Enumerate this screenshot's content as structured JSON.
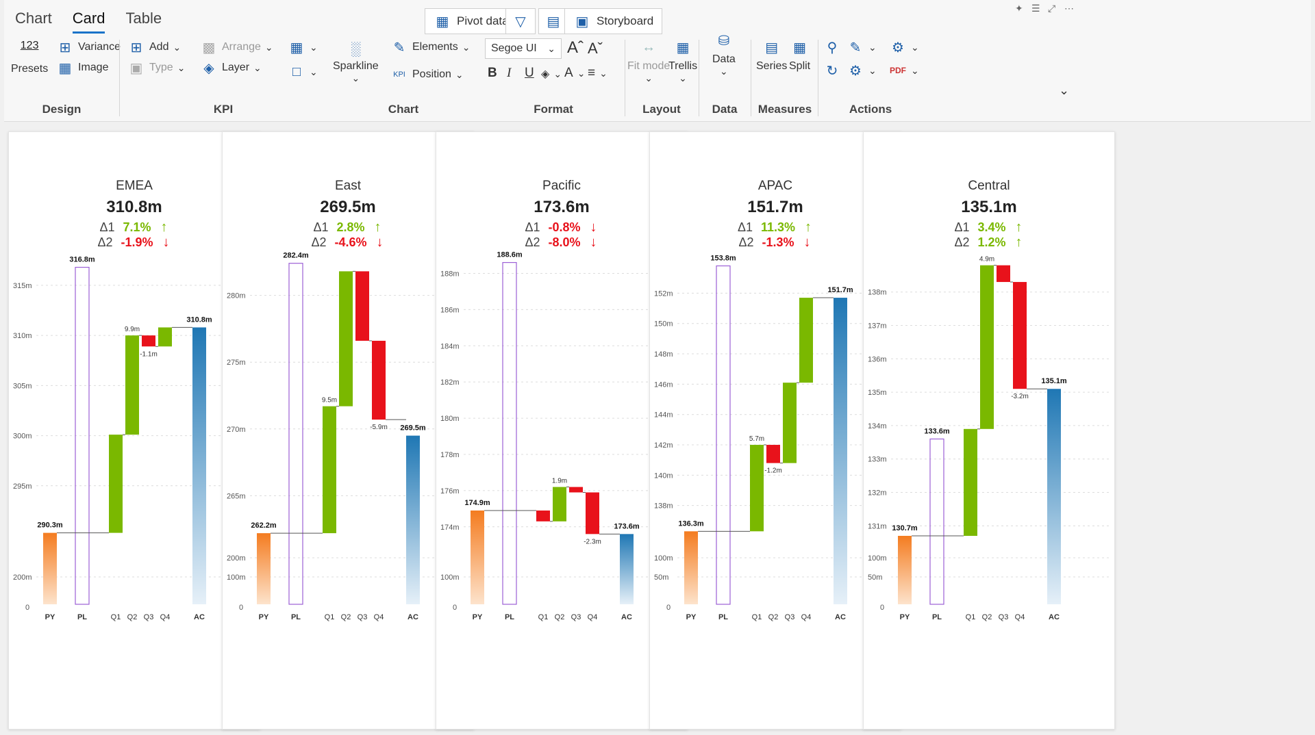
{
  "tabs": [
    {
      "label": "Chart"
    },
    {
      "label": "Card"
    },
    {
      "label": "Table"
    }
  ],
  "top_buttons": {
    "pivot": "Pivot data",
    "storyboard": "Storyboard"
  },
  "ribbon": {
    "design": {
      "label": "Design",
      "presets_num": "123",
      "presets": "Presets",
      "variance": "Variance",
      "image": "Image"
    },
    "kpi": {
      "label": "KPI",
      "add": "Add",
      "type": "Type",
      "arrange": "Arrange",
      "layer": "Layer"
    },
    "chart": {
      "label": "Chart",
      "sparkline": "Sparkline",
      "elements": "Elements",
      "position": "Position"
    },
    "format": {
      "label": "Format",
      "font": "Segoe UI",
      "bold": "B",
      "italic": "I",
      "underline": "U"
    },
    "layout": {
      "label": "Layout",
      "fit": "Fit mode",
      "trellis": "Trellis"
    },
    "data": {
      "label": "Data",
      "data_btn": "Data"
    },
    "measures": {
      "label": "Measures",
      "series": "Series",
      "split": "Split"
    },
    "actions": {
      "label": "Actions"
    }
  },
  "colors": {
    "py": "#f47c20",
    "pl": "#9b5fd6",
    "up": "#7ab800",
    "down": "#e8121b",
    "ac": "#1f77b4",
    "accent": "#1a73c9"
  },
  "delta_labels": {
    "d1": "Δ1",
    "d2": "Δ2"
  },
  "chart_data": [
    {
      "type": "bar",
      "title": "EMEA",
      "value": "310.8m",
      "d1": "7.1%",
      "d1_dir": "up",
      "d2": "-1.9%",
      "d2_dir": "down",
      "categories": [
        "PY",
        "PL",
        "Q1",
        "Q2",
        "Q3",
        "Q4",
        "AC"
      ],
      "py": 290.3,
      "pl": 316.8,
      "ac": 310.8,
      "quarters": [
        {
          "delta": 9.8,
          "label": ""
        },
        {
          "delta": 9.9,
          "label": "9.9m"
        },
        {
          "delta": -1.1,
          "label": "-1.1m"
        },
        {
          "delta": 1.9,
          "label": ""
        }
      ],
      "ylim": [
        290,
        318
      ],
      "ticks": [
        {
          "v": 315,
          "t": "315m"
        },
        {
          "v": 310,
          "t": "310m"
        },
        {
          "v": 305,
          "t": "305m"
        },
        {
          "v": 300,
          "t": "300m"
        },
        {
          "v": 295,
          "t": "295m"
        }
      ],
      "lower_ticks": [
        {
          "t": "200m"
        }
      ],
      "labels": {
        "py": "290.3m",
        "pl": "316.8m",
        "ac": "310.8m"
      }
    },
    {
      "type": "bar",
      "title": "East",
      "value": "269.5m",
      "d1": "2.8%",
      "d1_dir": "up",
      "d2": "-4.6%",
      "d2_dir": "down",
      "categories": [
        "PY",
        "PL",
        "Q1",
        "Q2",
        "Q3",
        "Q4",
        "AC"
      ],
      "py": 262.2,
      "pl": 282.4,
      "ac": 269.5,
      "quarters": [
        {
          "delta": 9.5,
          "label": "9.5m"
        },
        {
          "delta": 10.1,
          "label": ""
        },
        {
          "delta": -5.2,
          "label": ""
        },
        {
          "delta": -5.9,
          "label": "-5.9m"
        }
      ],
      "ylim": [
        262,
        283
      ],
      "ticks": [
        {
          "v": 280,
          "t": "280m"
        },
        {
          "v": 275,
          "t": "275m"
        },
        {
          "v": 270,
          "t": "270m"
        },
        {
          "v": 265,
          "t": "265m"
        }
      ],
      "lower_ticks": [
        {
          "t": "200m"
        },
        {
          "t": "100m"
        }
      ],
      "labels": {
        "py": "262.2m",
        "pl": "282.4m",
        "ac": "269.5m"
      }
    },
    {
      "type": "bar",
      "title": "Pacific",
      "value": "173.6m",
      "d1": "-0.8%",
      "d1_dir": "down",
      "d2": "-8.0%",
      "d2_dir": "down",
      "categories": [
        "PY",
        "PL",
        "Q1",
        "Q2",
        "Q3",
        "Q4",
        "AC"
      ],
      "py": 174.9,
      "pl": 188.6,
      "ac": 173.6,
      "quarters": [
        {
          "delta": -0.6,
          "label": ""
        },
        {
          "delta": 1.9,
          "label": "1.9m"
        },
        {
          "delta": -0.3,
          "label": ""
        },
        {
          "delta": -2.3,
          "label": "-2.3m"
        }
      ],
      "ylim": [
        173.5,
        189
      ],
      "ticks": [
        {
          "v": 188,
          "t": "188m"
        },
        {
          "v": 186,
          "t": "186m"
        },
        {
          "v": 184,
          "t": "184m"
        },
        {
          "v": 182,
          "t": "182m"
        },
        {
          "v": 180,
          "t": "180m"
        },
        {
          "v": 178,
          "t": "178m"
        },
        {
          "v": 176,
          "t": "176m"
        },
        {
          "v": 174,
          "t": "174m"
        }
      ],
      "lower_ticks": [
        {
          "t": "100m"
        }
      ],
      "labels": {
        "py": "174.9m",
        "pl": "188.6m",
        "ac": "173.6m"
      }
    },
    {
      "type": "bar",
      "title": "APAC",
      "value": "151.7m",
      "d1": "11.3%",
      "d1_dir": "up",
      "d2": "-1.3%",
      "d2_dir": "down",
      "categories": [
        "PY",
        "PL",
        "Q1",
        "Q2",
        "Q3",
        "Q4",
        "AC"
      ],
      "py": 136.3,
      "pl": 153.8,
      "ac": 151.7,
      "quarters": [
        {
          "delta": 5.7,
          "label": "5.7m"
        },
        {
          "delta": -1.2,
          "label": "-1.2m"
        },
        {
          "delta": 5.3,
          "label": ""
        },
        {
          "delta": 5.6,
          "label": ""
        }
      ],
      "ylim": [
        136,
        154.5
      ],
      "ticks": [
        {
          "v": 152,
          "t": "152m"
        },
        {
          "v": 150,
          "t": "150m"
        },
        {
          "v": 148,
          "t": "148m"
        },
        {
          "v": 146,
          "t": "146m"
        },
        {
          "v": 144,
          "t": "144m"
        },
        {
          "v": 142,
          "t": "142m"
        },
        {
          "v": 140,
          "t": "140m"
        },
        {
          "v": 138,
          "t": "138m"
        }
      ],
      "lower_ticks": [
        {
          "t": "100m"
        },
        {
          "t": "50m"
        }
      ],
      "labels": {
        "py": "136.3m",
        "pl": "153.8m",
        "ac": "151.7m"
      }
    },
    {
      "type": "bar",
      "title": "Central",
      "value": "135.1m",
      "d1": "3.4%",
      "d1_dir": "up",
      "d2": "1.2%",
      "d2_dir": "up",
      "categories": [
        "PY",
        "PL",
        "Q1",
        "Q2",
        "Q3",
        "Q4",
        "AC"
      ],
      "py": 130.7,
      "pl": 133.6,
      "ac": 135.1,
      "quarters": [
        {
          "delta": 3.2,
          "label": ""
        },
        {
          "delta": 4.9,
          "label": "4.9m"
        },
        {
          "delta": -0.5,
          "label": ""
        },
        {
          "delta": -3.2,
          "label": "-3.2m"
        }
      ],
      "ylim": [
        130.7,
        139.1
      ],
      "ticks": [
        {
          "v": 138,
          "t": "138m"
        },
        {
          "v": 137,
          "t": "137m"
        },
        {
          "v": 136,
          "t": "136m"
        },
        {
          "v": 135,
          "t": "135m"
        },
        {
          "v": 134,
          "t": "134m"
        },
        {
          "v": 133,
          "t": "133m"
        },
        {
          "v": 132,
          "t": "132m"
        },
        {
          "v": 131,
          "t": "131m"
        }
      ],
      "lower_ticks": [
        {
          "t": "100m"
        },
        {
          "t": "50m"
        }
      ],
      "labels": {
        "py": "130.7m",
        "pl": "133.6m",
        "ac": "135.1m"
      }
    }
  ],
  "zero_label": "0"
}
